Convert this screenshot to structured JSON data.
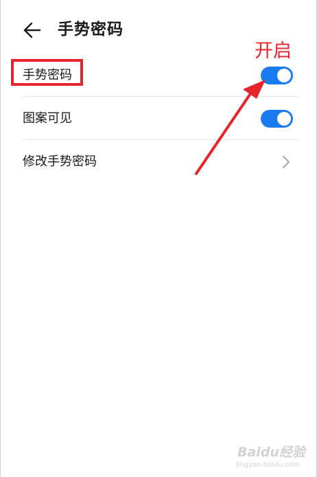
{
  "header": {
    "title": "手势密码",
    "back_icon": "arrow-left-icon"
  },
  "settings": {
    "items": [
      {
        "label": "手势密码",
        "control": "toggle",
        "enabled": true
      },
      {
        "label": "图案可见",
        "control": "toggle",
        "enabled": true
      },
      {
        "label": "修改手势密码",
        "control": "chevron",
        "icon": "chevron-right-icon"
      }
    ]
  },
  "annotation": {
    "label": "开启",
    "color": "#e8242a"
  },
  "watermark": {
    "brand": "Baidu经验",
    "domain": "jingyan.baidu.com"
  },
  "colors": {
    "accent": "#1a7bf0",
    "annotation": "#e8242a",
    "text": "#1a1a1a",
    "divider": "#e7e7e7"
  }
}
